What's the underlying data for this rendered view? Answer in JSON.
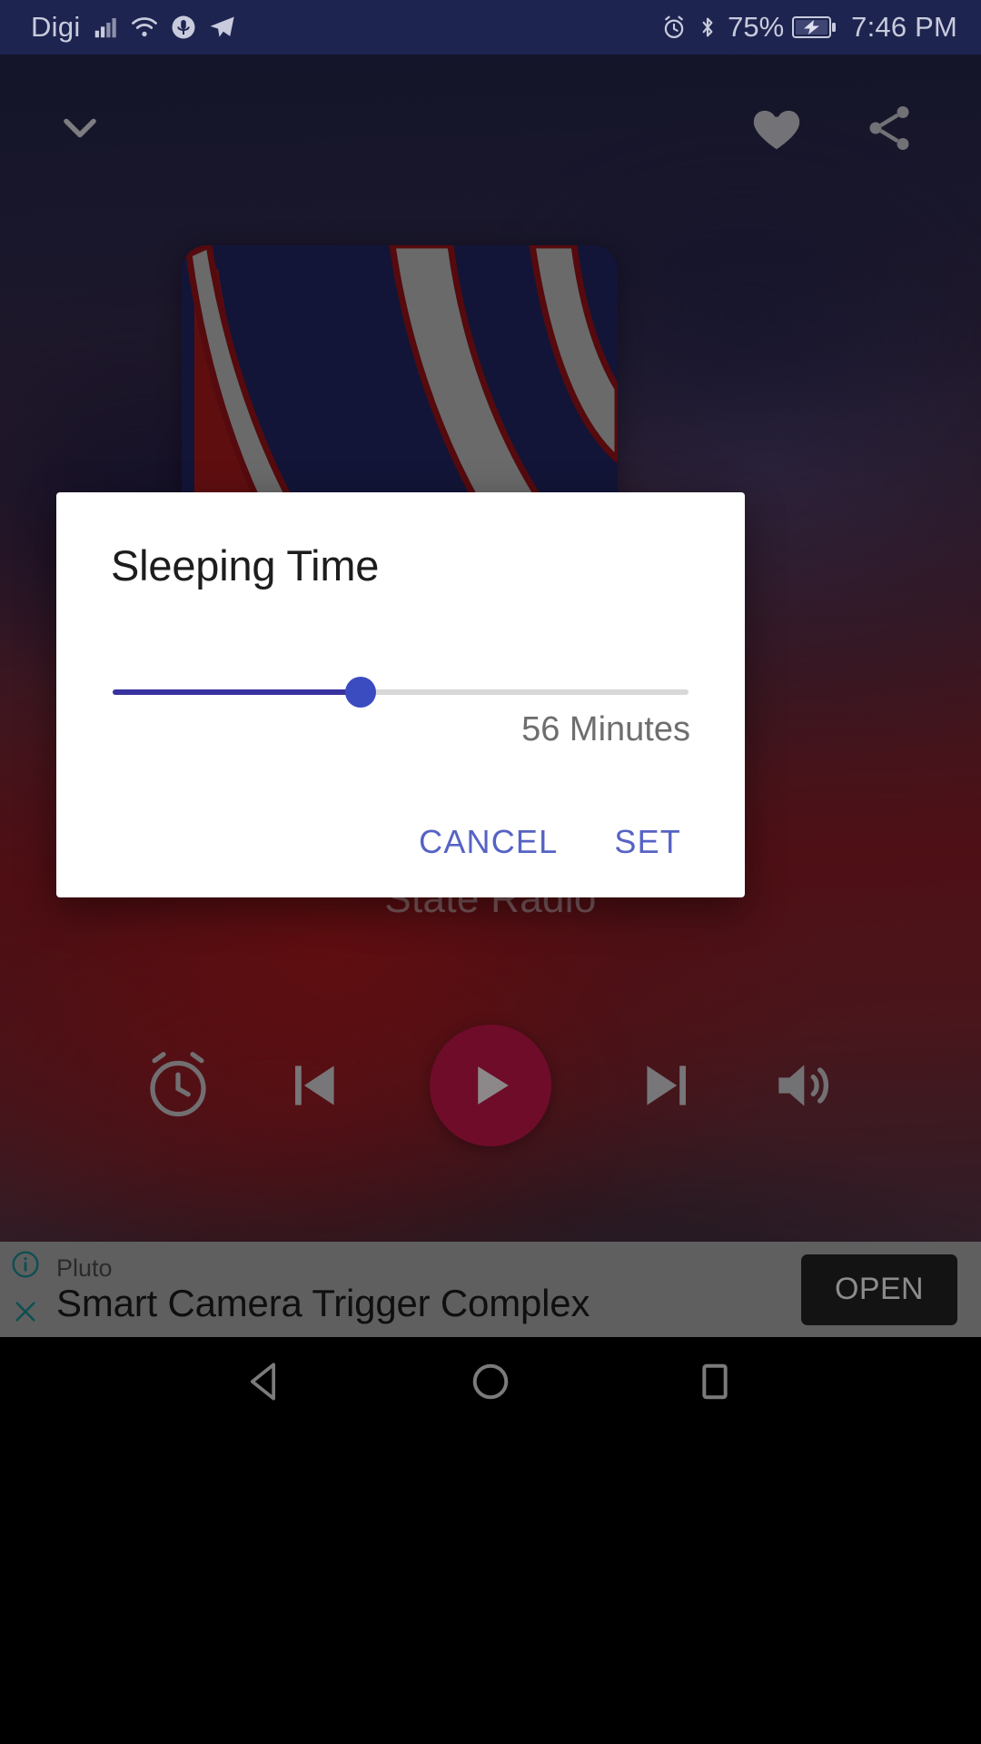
{
  "status_bar": {
    "carrier": "Digi",
    "battery_percent": "75%",
    "clock": "7:46 PM",
    "icons_left": [
      "signal-bars-icon",
      "wifi-icon",
      "microphone-icon",
      "telegram-icon"
    ],
    "icons_right": [
      "alarm-icon",
      "bluetooth-icon",
      "battery-charging-icon"
    ],
    "background_color": "#1e2450",
    "text_color": "#c8cbdc"
  },
  "app_bar": {
    "collapse_icon": "chevron-down-icon",
    "favorite_icon": "heart-icon",
    "share_icon": "share-icon"
  },
  "player": {
    "album_art_name": "album-art",
    "track_title": "State Radio",
    "accent_color": "#a4123f",
    "controls": [
      {
        "name": "sleep-timer-button",
        "icon": "alarm-clock-icon"
      },
      {
        "name": "previous-button",
        "icon": "skip-previous-icon"
      },
      {
        "name": "play-button",
        "icon": "play-icon"
      },
      {
        "name": "next-button",
        "icon": "skip-next-icon"
      },
      {
        "name": "volume-button",
        "icon": "volume-up-icon"
      }
    ]
  },
  "dialog": {
    "title": "Sleeping Time",
    "value_label": "56 Minutes",
    "slider": {
      "value": 56,
      "min": 0,
      "max": 130,
      "fill_percent": 43,
      "track_color": "#d8d8d8",
      "fill_color": "#3832a0",
      "thumb_color": "#3b4cc0"
    },
    "cancel_label": "CANCEL",
    "set_label": "SET",
    "button_color": "#5663c4"
  },
  "ad": {
    "advertiser": "Pluto",
    "headline": "Smart Camera Trigger Complex",
    "open_label": "OPEN",
    "info_icon": "info-circle-icon",
    "close_icon": "close-icon",
    "icon_color": "#14757a",
    "background_color": "#8d8d8d"
  },
  "nav_bar": {
    "back_icon": "back-triangle-icon",
    "home_icon": "home-circle-icon",
    "recents_icon": "recents-square-icon"
  }
}
